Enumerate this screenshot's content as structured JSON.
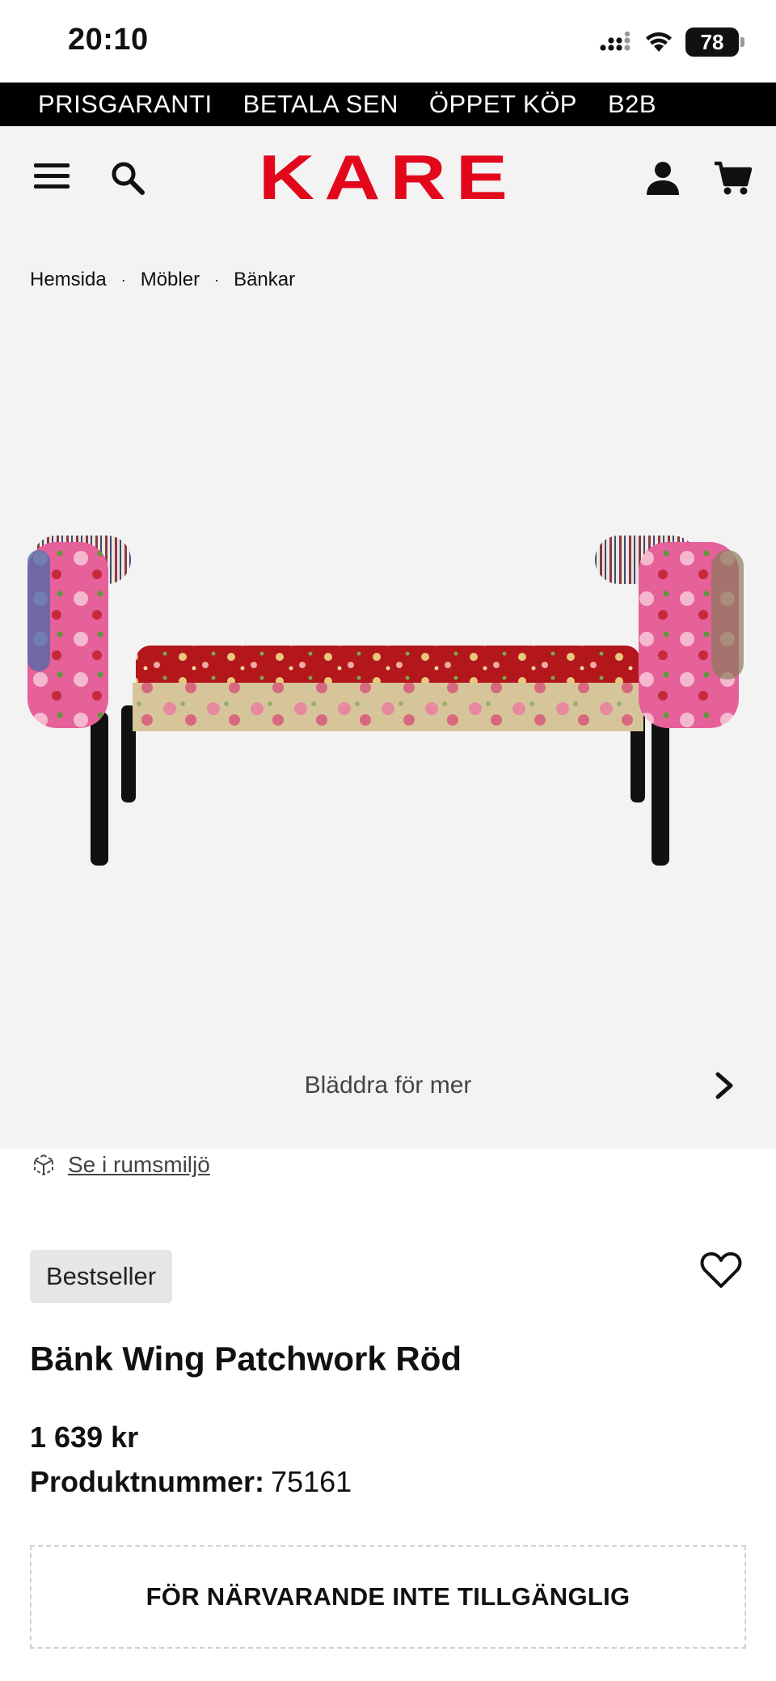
{
  "status_bar": {
    "time": "20:10",
    "battery": "78"
  },
  "promo_bar": {
    "items": [
      "PRISGARANTI",
      "BETALA SEN",
      "ÖPPET KÖP",
      "B2B"
    ]
  },
  "header": {
    "logo_text": "KARE",
    "brand_color": "#e3071b"
  },
  "breadcrumb": {
    "items": [
      "Hemsida",
      "Möbler",
      "Bänkar"
    ],
    "separator": "·"
  },
  "gallery": {
    "browse_label": "Bläddra för mer"
  },
  "room_view": {
    "label": "Se i rumsmiljö"
  },
  "product": {
    "badge": "Bestseller",
    "title": "Bänk Wing Patchwork Röd",
    "price": "1 639 kr",
    "sku_label": "Produktnummer:",
    "sku_value": "75161",
    "availability": "FÖR NÄRVARANDE INTE TILLGÄNGLIG"
  },
  "icons": {
    "menu": "hamburger-icon",
    "search": "search-icon",
    "account": "user-icon",
    "cart": "cart-icon",
    "next": "chevron-right-icon",
    "room": "ar-cube-icon",
    "wishlist": "heart-icon"
  }
}
